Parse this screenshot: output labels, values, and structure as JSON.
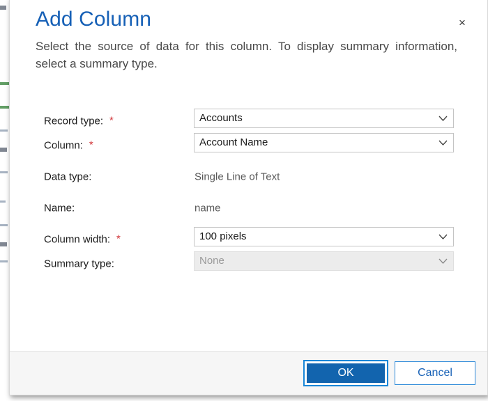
{
  "dialog": {
    "title": "Add Column",
    "description": "Select the source of data for this column. To display summary information, select a summary type.",
    "close_label": "×"
  },
  "form": {
    "fields": [
      {
        "label": "Record type:",
        "required": true,
        "required_mark": "*",
        "type": "select",
        "value": "Accounts",
        "options": [
          "Accounts"
        ],
        "disabled": false
      },
      {
        "label": "Column:",
        "required": true,
        "required_mark": "*",
        "type": "select",
        "value": "Account Name",
        "options": [
          "Account Name"
        ],
        "disabled": false
      },
      {
        "label": "Data type:",
        "required": false,
        "type": "static",
        "value": "Single Line of Text"
      },
      {
        "label": "Name:",
        "required": false,
        "type": "static",
        "value": "name"
      },
      {
        "label": "Column width:",
        "required": true,
        "required_mark": "*",
        "type": "select",
        "value": "100 pixels",
        "options": [
          "100 pixels"
        ],
        "disabled": false
      },
      {
        "label": "Summary type:",
        "required": false,
        "type": "select",
        "value": "None",
        "options": [
          "None"
        ],
        "disabled": true
      }
    ]
  },
  "footer": {
    "ok_label": "OK",
    "cancel_label": "Cancel"
  },
  "colors": {
    "title_blue": "#1660b6",
    "required_red": "#d13438",
    "primary_button": "#1264ae",
    "focus_ring": "#1886d8",
    "disabled_field": "#e4e4e4",
    "footer_bg": "#f6f6f6"
  }
}
